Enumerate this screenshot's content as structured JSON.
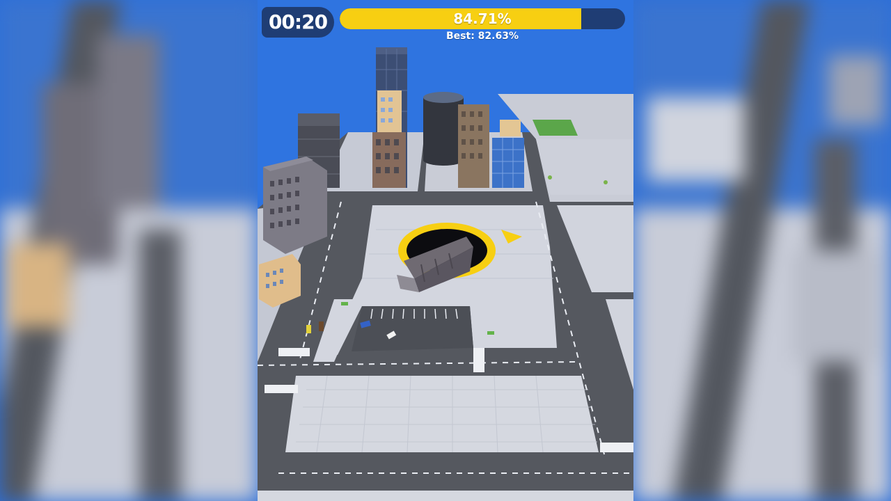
{
  "hud": {
    "timer": "00:20",
    "progress_label": "84.71%",
    "progress_value": 0.8471,
    "best_label": "Best: 82.63%"
  },
  "colors": {
    "hud_dark": "#1f3d74",
    "progress_yellow": "#f7cf12",
    "sky_blue": "#2f74e0",
    "hole_ring": "#f7cf12"
  },
  "icons": {
    "direction_arrow": "yellow-triangle-arrow"
  }
}
